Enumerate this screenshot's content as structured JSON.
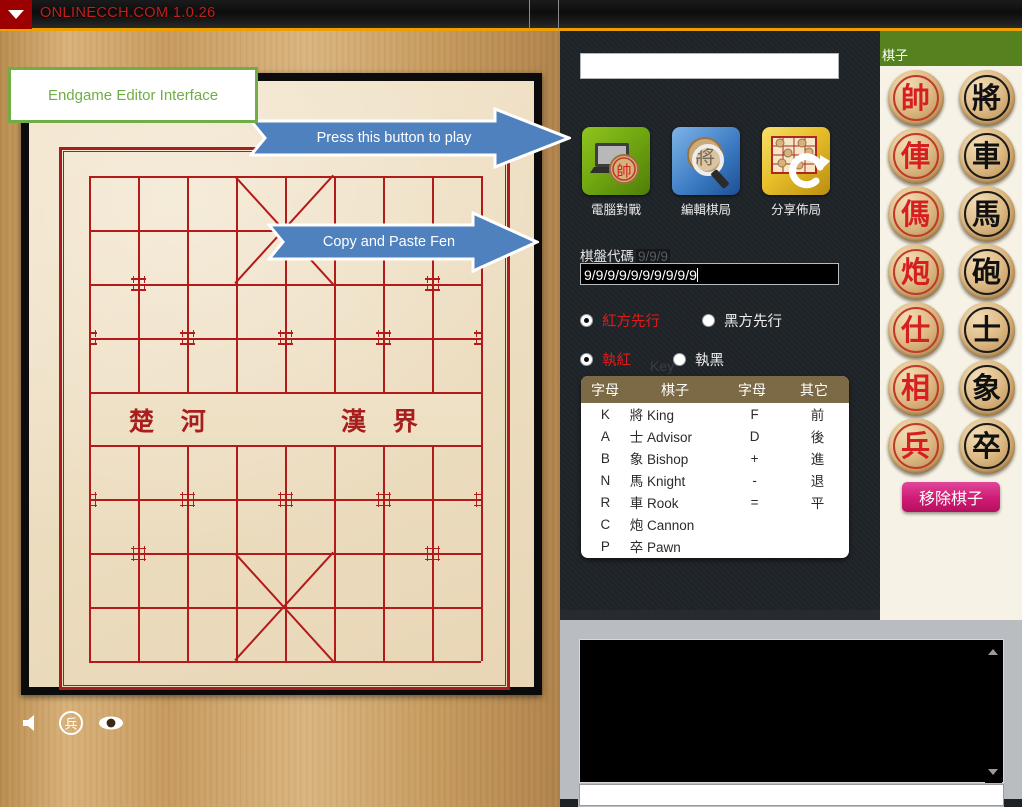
{
  "titlebar": {
    "app_title": "ONLINECCH.COM 1.0.26",
    "dropdown_icon": "chevron-down-icon"
  },
  "annotations": {
    "label_box": "Endgame Editor Interface",
    "callout_play": "Press this button to play",
    "callout_fen": "Copy and Paste Fen"
  },
  "board": {
    "river_left": "楚 河",
    "river_right": "漢 界",
    "bottom_icons": [
      {
        "name": "sound-icon",
        "glyph": "speaker"
      },
      {
        "name": "piece-toggle-icon",
        "glyph": "兵"
      },
      {
        "name": "eye-icon",
        "glyph": "eye"
      }
    ]
  },
  "right_panel": {
    "top_input_value": "",
    "top_input_placeholder": "",
    "tools": [
      {
        "label": "電腦對戰",
        "icon": "laptop-chess-icon",
        "color": "#6fa510"
      },
      {
        "label": "編輯棋局",
        "icon": "magnifier-piece-icon",
        "color": "#3e7dc4"
      },
      {
        "label": "分享佈局",
        "icon": "board-refresh-icon",
        "color": "#e8bf2a"
      }
    ],
    "fen": {
      "label": "棋盤代碼",
      "ghost": "9/9/9",
      "value": "9/9/9/9/9/9/9/9/9/9"
    },
    "radios": [
      {
        "label": "紅方先行",
        "selected": true,
        "color": "#e01b1b"
      },
      {
        "label": "黑方先行",
        "selected": false,
        "color": "#f0f0f0"
      },
      {
        "label": "執紅",
        "selected": true,
        "color": "#e01b1b"
      },
      {
        "label": "執黑",
        "selected": false,
        "color": "#f0f0f0"
      }
    ],
    "key_description": {
      "caption": "Key Description",
      "headers": [
        "字母",
        "棋子",
        "字母",
        "其它"
      ],
      "rows": [
        {
          "letter": "K",
          "cn": "將",
          "en": "King",
          "letter2": "F",
          "other": "前"
        },
        {
          "letter": "A",
          "cn": "士",
          "en": "Advisor",
          "letter2": "D",
          "other": "後"
        },
        {
          "letter": "B",
          "cn": "象",
          "en": "Bishop",
          "letter2": "+",
          "other": "進"
        },
        {
          "letter": "N",
          "cn": "馬",
          "en": "Knight",
          "letter2": "-",
          "other": "退"
        },
        {
          "letter": "R",
          "cn": "車",
          "en": "Rook",
          "letter2": "=",
          "other": "平"
        },
        {
          "letter": "C",
          "cn": "炮",
          "en": "Cannon",
          "letter2": "",
          "other": ""
        },
        {
          "letter": "P",
          "cn": "卒",
          "en": "Pawn",
          "letter2": "",
          "other": ""
        }
      ]
    }
  },
  "palette": {
    "header": "棋子",
    "pieces": [
      {
        "glyph": "帥",
        "side": "red"
      },
      {
        "glyph": "將",
        "side": "black"
      },
      {
        "glyph": "俥",
        "side": "red"
      },
      {
        "glyph": "車",
        "side": "black"
      },
      {
        "glyph": "傌",
        "side": "red"
      },
      {
        "glyph": "馬",
        "side": "black"
      },
      {
        "glyph": "炮",
        "side": "red"
      },
      {
        "glyph": "砲",
        "side": "black"
      },
      {
        "glyph": "仕",
        "side": "red"
      },
      {
        "glyph": "士",
        "side": "black"
      },
      {
        "glyph": "相",
        "side": "red"
      },
      {
        "glyph": "象",
        "side": "black"
      },
      {
        "glyph": "兵",
        "side": "red"
      },
      {
        "glyph": "卒",
        "side": "black"
      }
    ],
    "remove_button": "移除棋子"
  },
  "chat": {
    "log_text": "",
    "input_value": "",
    "input_placeholder": ""
  },
  "colors": {
    "accent_orange": "#eda000",
    "title_red": "#c3201c",
    "green_header": "#55821f",
    "callout_blue": "#4e81bd",
    "label_green": "#70ad47",
    "remove_pink": "#cf1b74",
    "board_line_red": "#b31b1b"
  }
}
